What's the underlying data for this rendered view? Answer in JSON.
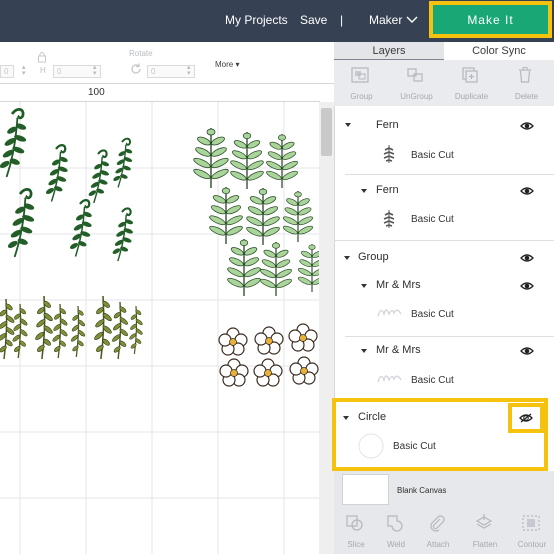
{
  "topbar": {
    "my_projects": "My Projects",
    "save": "Save",
    "separator": "|",
    "maker": "Maker",
    "make_it": "Make It",
    "bg_color": "#364253",
    "make_it_color": "#1aa776",
    "highlight_color": "#f5c20e"
  },
  "toolbar": {
    "h_label": "H",
    "w_value": "0",
    "h_value": "0",
    "rotate_label": "Rotate",
    "rotate_value": "0",
    "more_label": "More"
  },
  "canvas": {
    "ruler_number": "100"
  },
  "panel": {
    "tabs": [
      "Layers",
      "Color Sync"
    ],
    "actions": [
      "Group",
      "UnGroup",
      "Duplicate",
      "Delete"
    ],
    "layers": [
      {
        "name": "Fern",
        "sub": "Basic Cut"
      },
      {
        "name": "Fern",
        "sub": "Basic Cut"
      },
      {
        "name": "Group"
      },
      {
        "name": "Mr & Mrs",
        "sub": "Basic Cut"
      },
      {
        "name": "Mr & Mrs",
        "sub": "Basic Cut"
      },
      {
        "name": "Circle",
        "sub": "Basic Cut"
      }
    ],
    "blank_canvas": "Blank Canvas",
    "bottom_tools": [
      "Slice",
      "Weld",
      "Attach",
      "Flatten",
      "Contour"
    ]
  }
}
